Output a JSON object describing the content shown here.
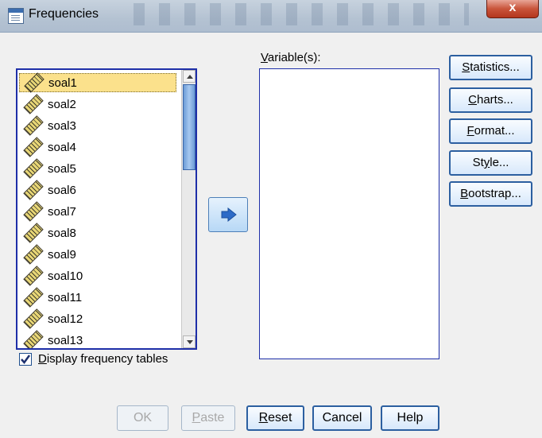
{
  "window": {
    "title": "Frequencies",
    "close_symbol": "x",
    "icon": "spss-table-icon"
  },
  "source_list": {
    "item_icon": "ruler-icon",
    "selected_index": 0,
    "items": [
      "soal1",
      "soal2",
      "soal3",
      "soal4",
      "soal5",
      "soal6",
      "soal7",
      "soal8",
      "soal9",
      "soal10",
      "soal11",
      "soal12",
      "soal13"
    ]
  },
  "move_button": {
    "icon": "arrow-right-icon"
  },
  "variables": {
    "label": "Variable(s):",
    "items": []
  },
  "side_buttons": {
    "statistics": "Statistics...",
    "charts": "Charts...",
    "format": "Format...",
    "style": "Style...",
    "bootstrap": "Bootstrap..."
  },
  "options": {
    "display_frequency_tables": {
      "label": "Display frequency tables",
      "checked": true
    }
  },
  "bottom_buttons": {
    "ok": "OK",
    "paste": "Paste",
    "reset": "Reset",
    "cancel": "Cancel",
    "help": "Help"
  }
}
